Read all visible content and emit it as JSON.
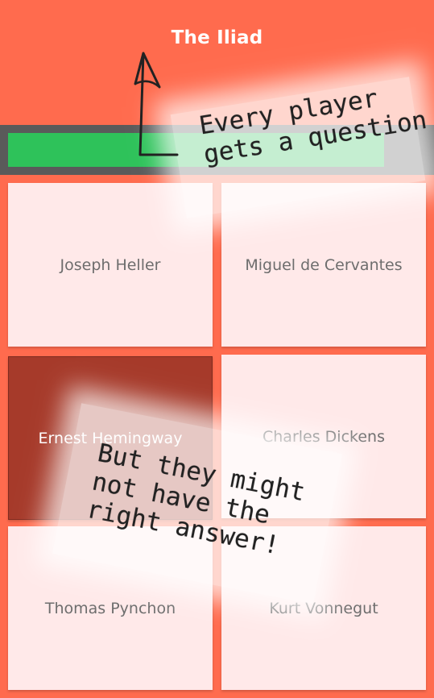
{
  "header": {
    "title": "The Iliad"
  },
  "progress": {
    "fraction": 0.9
  },
  "answers": [
    {
      "label": "Joseph Heller",
      "selected": false
    },
    {
      "label": "Miguel de Cervantes",
      "selected": false
    },
    {
      "label": "Ernest Hemingway",
      "selected": true
    },
    {
      "label": "Charles Dickens",
      "selected": false
    },
    {
      "label": "Thomas Pynchon",
      "selected": false
    },
    {
      "label": "Kurt Vonnegut",
      "selected": false
    }
  ],
  "annotations": {
    "top_note": "Every player\ngets a question",
    "bottom_note": "But they might\nnot have the\nright answer!"
  },
  "colors": {
    "background": "#ff6b4e",
    "progress_track": "#5a5a5a",
    "progress_fill": "#2ec25a",
    "tile": "#ffe9e9",
    "tile_selected": "#a63a2a"
  }
}
